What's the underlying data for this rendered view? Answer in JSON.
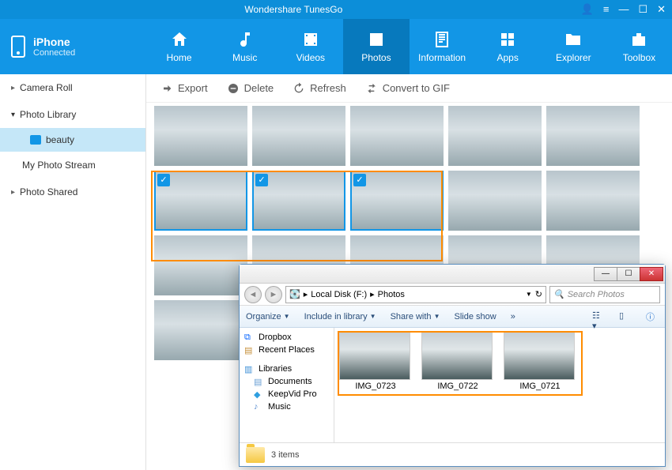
{
  "app": {
    "title": "Wondershare TunesGo"
  },
  "device": {
    "name": "iPhone",
    "status": "Connected"
  },
  "nav": [
    {
      "label": "Home"
    },
    {
      "label": "Music"
    },
    {
      "label": "Videos"
    },
    {
      "label": "Photos"
    },
    {
      "label": "Information"
    },
    {
      "label": "Apps"
    },
    {
      "label": "Explorer"
    },
    {
      "label": "Toolbox"
    }
  ],
  "sidebar": {
    "camera_roll": "Camera Roll",
    "photo_library": "Photo Library",
    "beauty": "beauty",
    "my_photo_stream": "My Photo Stream",
    "photo_shared": "Photo Shared"
  },
  "toolbar": {
    "export": "Export",
    "delete": "Delete",
    "refresh": "Refresh",
    "convert": "Convert to GIF"
  },
  "explorer": {
    "path_disk": "Local Disk (F:)",
    "path_folder": "Photos",
    "search_placeholder": "Search Photos",
    "cmd_organize": "Organize",
    "cmd_include": "Include in library",
    "cmd_share": "Share with",
    "cmd_slide": "Slide show",
    "tree": {
      "dropbox": "Dropbox",
      "recent": "Recent Places",
      "libraries": "Libraries",
      "documents": "Documents",
      "keepvid": "KeepVid Pro",
      "music": "Music"
    },
    "files": [
      {
        "name": "IMG_0723"
      },
      {
        "name": "IMG_0722"
      },
      {
        "name": "IMG_0721"
      }
    ],
    "status": "3 items"
  }
}
